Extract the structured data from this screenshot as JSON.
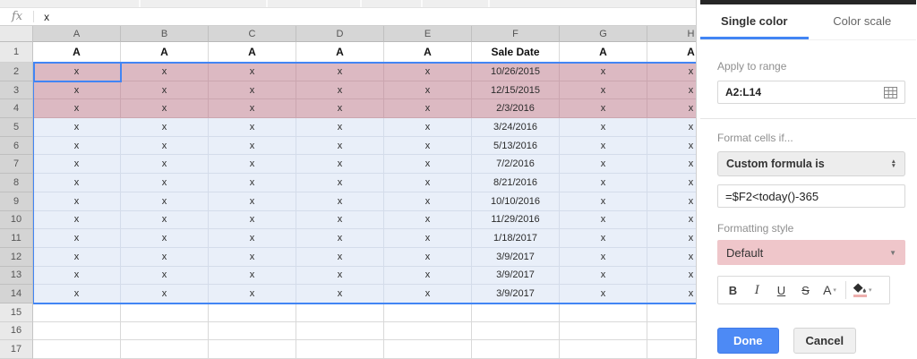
{
  "formula_bar": {
    "fx_label": "fx",
    "value": "x"
  },
  "sheet": {
    "column_letters": [
      "A",
      "B",
      "C",
      "D",
      "E",
      "F",
      "G",
      "H"
    ],
    "rows": [
      {
        "n": "1",
        "kind": "header",
        "sel": false,
        "cells": [
          "A",
          "A",
          "A",
          "A",
          "A",
          "Sale Date",
          "A",
          "A"
        ]
      },
      {
        "n": "2",
        "kind": "pink",
        "sel": true,
        "cells": [
          "x",
          "x",
          "x",
          "x",
          "x",
          "10/26/2015",
          "x",
          "x"
        ]
      },
      {
        "n": "3",
        "kind": "pink",
        "sel": true,
        "cells": [
          "x",
          "x",
          "x",
          "x",
          "x",
          "12/15/2015",
          "x",
          "x"
        ]
      },
      {
        "n": "4",
        "kind": "pink",
        "sel": true,
        "cells": [
          "x",
          "x",
          "x",
          "x",
          "x",
          "2/3/2016",
          "x",
          "x"
        ]
      },
      {
        "n": "5",
        "kind": "blue",
        "sel": true,
        "cells": [
          "x",
          "x",
          "x",
          "x",
          "x",
          "3/24/2016",
          "x",
          "x"
        ]
      },
      {
        "n": "6",
        "kind": "blue",
        "sel": true,
        "cells": [
          "x",
          "x",
          "x",
          "x",
          "x",
          "5/13/2016",
          "x",
          "x"
        ]
      },
      {
        "n": "7",
        "kind": "blue",
        "sel": true,
        "cells": [
          "x",
          "x",
          "x",
          "x",
          "x",
          "7/2/2016",
          "x",
          "x"
        ]
      },
      {
        "n": "8",
        "kind": "blue",
        "sel": true,
        "cells": [
          "x",
          "x",
          "x",
          "x",
          "x",
          "8/21/2016",
          "x",
          "x"
        ]
      },
      {
        "n": "9",
        "kind": "blue",
        "sel": true,
        "cells": [
          "x",
          "x",
          "x",
          "x",
          "x",
          "10/10/2016",
          "x",
          "x"
        ]
      },
      {
        "n": "10",
        "kind": "blue",
        "sel": true,
        "cells": [
          "x",
          "x",
          "x",
          "x",
          "x",
          "11/29/2016",
          "x",
          "x"
        ]
      },
      {
        "n": "11",
        "kind": "blue",
        "sel": true,
        "cells": [
          "x",
          "x",
          "x",
          "x",
          "x",
          "1/18/2017",
          "x",
          "x"
        ]
      },
      {
        "n": "12",
        "kind": "blue",
        "sel": true,
        "cells": [
          "x",
          "x",
          "x",
          "x",
          "x",
          "3/9/2017",
          "x",
          "x"
        ]
      },
      {
        "n": "13",
        "kind": "blue",
        "sel": true,
        "cells": [
          "x",
          "x",
          "x",
          "x",
          "x",
          "3/9/2017",
          "x",
          "x"
        ]
      },
      {
        "n": "14",
        "kind": "blue",
        "sel": true,
        "cells": [
          "x",
          "x",
          "x",
          "x",
          "x",
          "3/9/2017",
          "x",
          "x"
        ]
      },
      {
        "n": "15",
        "kind": "plain",
        "sel": false,
        "cells": [
          "",
          "",
          "",
          "",
          "",
          "",
          "",
          ""
        ]
      },
      {
        "n": "16",
        "kind": "plain",
        "sel": false,
        "cells": [
          "",
          "",
          "",
          "",
          "",
          "",
          "",
          ""
        ]
      },
      {
        "n": "17",
        "kind": "plain",
        "sel": false,
        "cells": [
          "",
          "",
          "",
          "",
          "",
          "",
          "",
          ""
        ]
      }
    ]
  },
  "panel": {
    "tabs": {
      "single_color": "Single color",
      "color_scale": "Color scale"
    },
    "apply_to_range_label": "Apply to range",
    "range_value": "A2:L14",
    "format_cells_if_label": "Format cells if...",
    "condition_value": "Custom formula is",
    "formula_value": "=$F2<today()-365",
    "formatting_style_label": "Formatting style",
    "style_value": "Default",
    "toolbar": {
      "bold": "B",
      "italic": "I",
      "underline": "U",
      "strikethrough": "S",
      "text_color": "A"
    },
    "done_label": "Done",
    "cancel_label": "Cancel"
  },
  "icons": {
    "stepper_up": "▲",
    "stepper_down": "▼",
    "dropdown_caret": "▼",
    "text_color_caret": "▾",
    "fill_color_caret": "▾"
  },
  "colors": {
    "accent_blue": "#4285f4",
    "selected_pink": "#dcb9c2",
    "selection_blue": "#e9eff9",
    "format_pink": "#efc6ca",
    "done_blue": "#4d8af5"
  }
}
